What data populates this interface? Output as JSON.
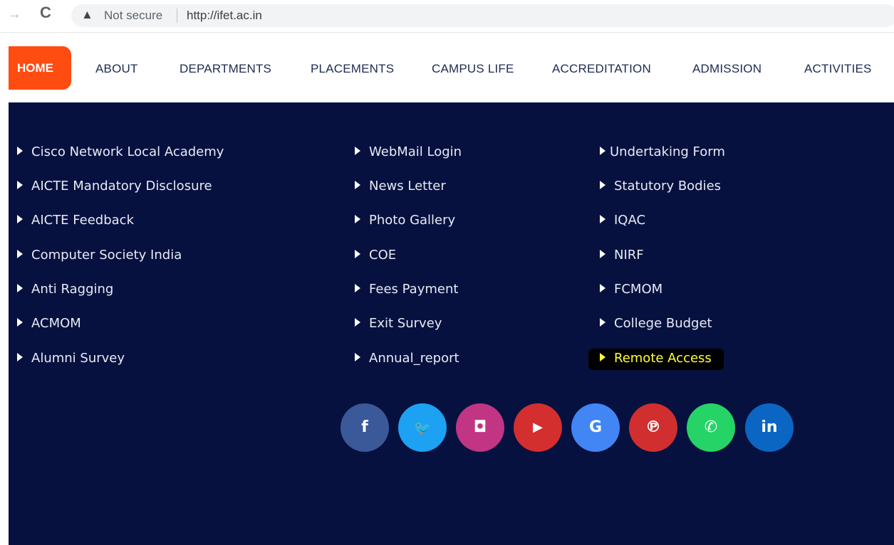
{
  "browser": {
    "back_glyph": "→",
    "reload_glyph": "C",
    "warning_glyph": "▲",
    "security_text": "Not secure",
    "url": "http://ifet.ac.in"
  },
  "nav": {
    "items": [
      "HOME",
      "ABOUT",
      "DEPARTMENTS",
      "PLACEMENTS",
      "CAMPUS LIFE",
      "ACCREDITATION",
      "ADMISSION",
      "ACTIVITIES"
    ],
    "active": "HOME",
    "active_color": "#ff4c11"
  },
  "footer": {
    "background": "#06113f",
    "columns": [
      [
        "Cisco Network Local Academy",
        "AICTE Mandatory Disclosure",
        "AICTE Feedback",
        "Computer Society India",
        "Anti Ragging",
        "ACMOM",
        "Alumni Survey"
      ],
      [
        "WebMail Login",
        "News Letter",
        "Photo Gallery",
        "COE",
        "Fees Payment",
        "Exit Survey",
        "Annual_report"
      ],
      [
        "Undertaking Form",
        "Statutory Bodies",
        "IQAC",
        "NIRF",
        "FCMOM",
        "College Budget",
        "Remote Access"
      ]
    ],
    "highlighted_link": "Remote Access",
    "social": [
      {
        "icon": "facebook-icon",
        "glyph": "f",
        "color": "#3b5998"
      },
      {
        "icon": "twitter-icon",
        "glyph": "🐦",
        "color": "#1da1f2"
      },
      {
        "icon": "instagram-icon",
        "glyph": "◘",
        "color": "#c13584"
      },
      {
        "icon": "youtube-icon",
        "glyph": "▶",
        "color": "#d32f2f"
      },
      {
        "icon": "google-icon",
        "glyph": "G",
        "color": "#4285f4"
      },
      {
        "icon": "pinterest-icon",
        "glyph": "℗",
        "color": "#d12f2f"
      },
      {
        "icon": "whatsapp-icon",
        "glyph": "✆",
        "color": "#25d366"
      },
      {
        "icon": "linkedin-icon",
        "glyph": "in",
        "color": "#0a66c2"
      }
    ]
  }
}
